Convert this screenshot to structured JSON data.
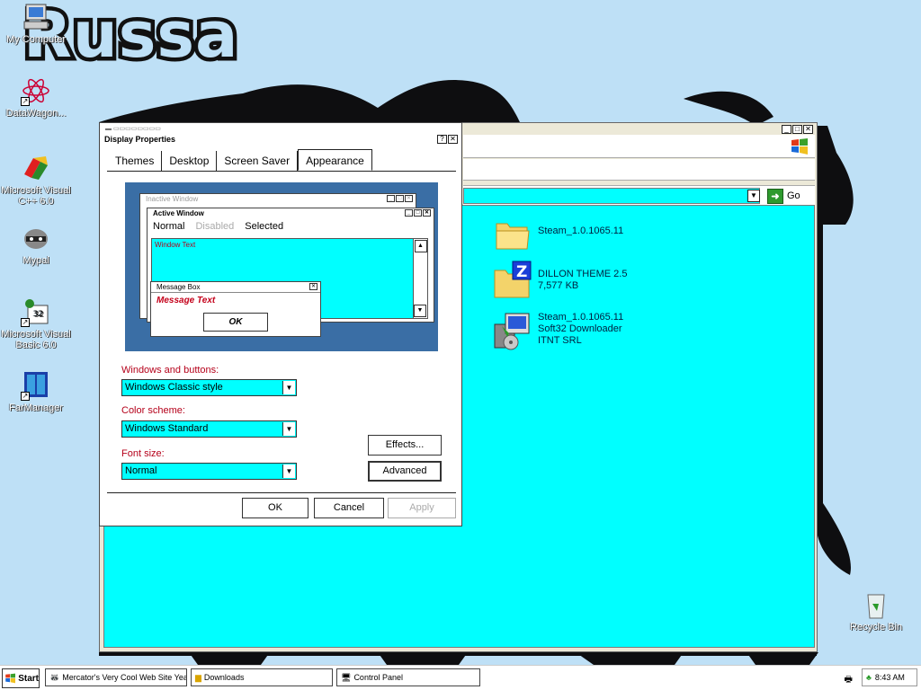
{
  "colors": {
    "desktop": "#bee0f6",
    "cyan": "#00ffff",
    "label_red": "#b5001a"
  },
  "desktop": {
    "wallpaper_text": "Russa",
    "icons": [
      {
        "label": "My Computer",
        "icon": "computer-icon"
      },
      {
        "label": "DataWagon...",
        "icon": "atom-icon"
      },
      {
        "label": "Microsoft Visual C++ 6.0",
        "icon": "visual-cpp-icon"
      },
      {
        "label": "Mypal",
        "icon": "raccoon-icon"
      },
      {
        "label": "Microsoft Visual Basic 6.0",
        "icon": "visual-basic-icon"
      },
      {
        "label": "FarManager",
        "icon": "far-manager-icon"
      },
      {
        "label": "Recycle Bin",
        "icon": "recycle-bin-icon"
      }
    ]
  },
  "explorer": {
    "go_label": "Go",
    "files": [
      {
        "name": "Steam_1.0.1065.11",
        "line2": "",
        "line3": "",
        "icon": "folder-icon"
      },
      {
        "name": "DILLON THEME 2.5",
        "line2": "7,577 KB",
        "line3": "",
        "icon": "zip-folder-icon"
      },
      {
        "name": "Steam_1.0.1065.11",
        "line2": "Soft32 Downloader",
        "line3": "ITNT SRL",
        "icon": "installer-icon"
      }
    ]
  },
  "dialog": {
    "title": "Display Properties",
    "tabs": [
      "Themes",
      "Desktop",
      "Screen Saver",
      "Appearance"
    ],
    "active_tab": "Appearance",
    "preview": {
      "inactive_title": "Inactive Window",
      "active_title": "Active Window",
      "menu": [
        "Normal",
        "Disabled",
        "Selected"
      ],
      "window_text": "Window Text",
      "msgbox_title": "Message Box",
      "msgbox_text": "Message Text",
      "msgbox_ok": "OK"
    },
    "windows_buttons_label": "Windows and buttons:",
    "windows_buttons_value": "Windows Classic style",
    "color_scheme_label": "Color scheme:",
    "color_scheme_value": "Windows Standard",
    "font_size_label": "Font size:",
    "font_size_value": "Normal",
    "effects_label": "Effects...",
    "advanced_label": "Advanced",
    "ok_label": "OK",
    "cancel_label": "Cancel",
    "apply_label": "Apply"
  },
  "taskbar": {
    "start_label": "Start",
    "tasks": [
      "Mercator's Very Cool Web Site Yeah ...",
      "Downloads",
      "Control Panel"
    ],
    "clock": "8:43 AM"
  }
}
